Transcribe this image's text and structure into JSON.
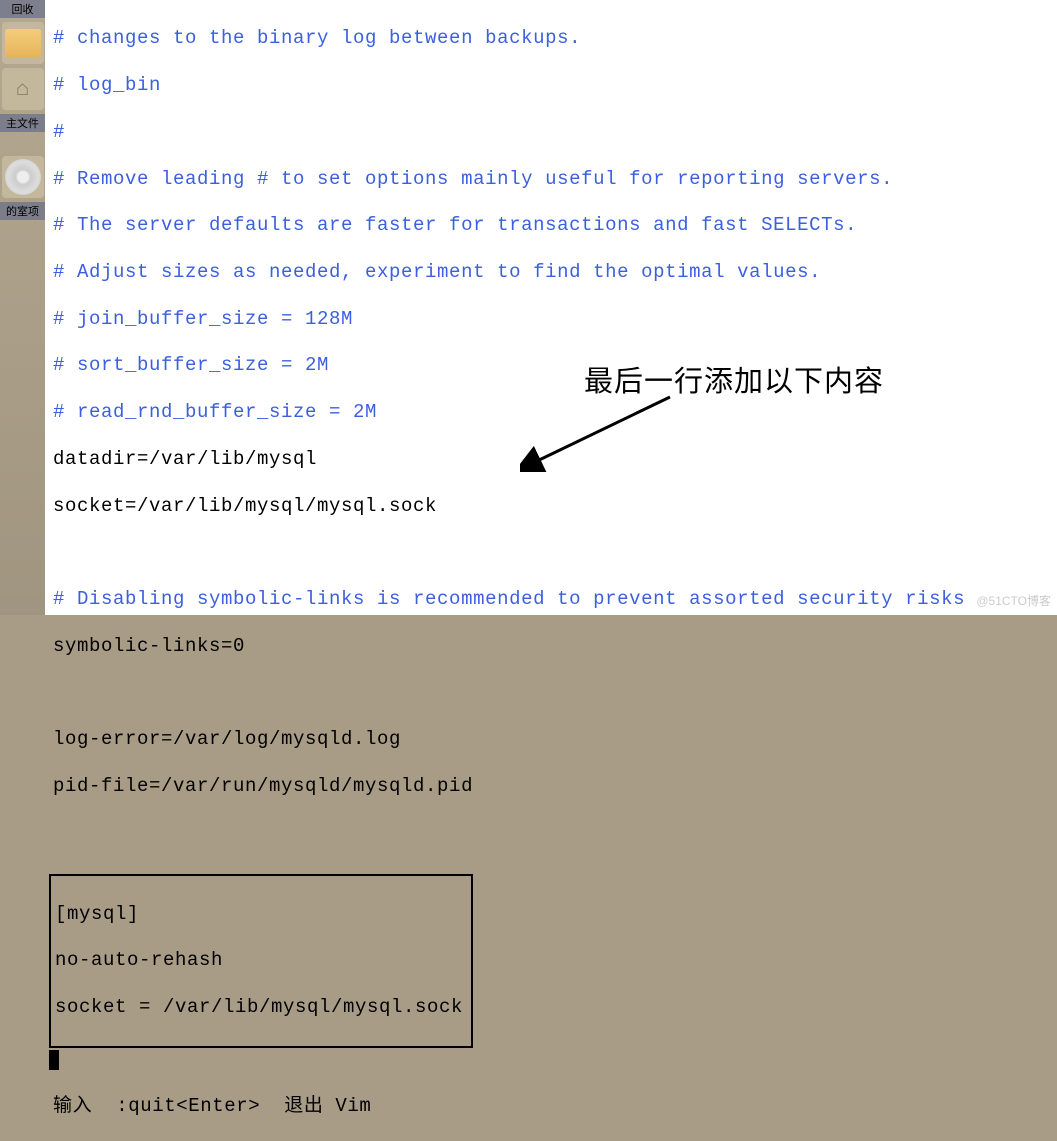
{
  "desktop": {
    "recycle_label": "回收",
    "main_files_label": "主文件",
    "drive_label": "的室项"
  },
  "lines": {
    "l0": "# changes to the binary log between backups.",
    "l1": "# log_bin",
    "l2": "#",
    "l3": "# Remove leading # to set options mainly useful for reporting servers.",
    "l4": "# The server defaults are faster for transactions and fast SELECTs.",
    "l5": "# Adjust sizes as needed, experiment to find the optimal values.",
    "l6": "# join_buffer_size = 128M",
    "l7": "# sort_buffer_size = 2M",
    "l8": "# read_rnd_buffer_size = 2M",
    "l9": "datadir=/var/lib/mysql",
    "l10": "socket=/var/lib/mysql/mysql.sock",
    "l11": " ",
    "l12": "# Disabling symbolic-links is recommended to prevent assorted security risks",
    "l13": "symbolic-links=0",
    "l14": " ",
    "l15": "log-error=/var/log/mysqld.log",
    "l16": "pid-file=/var/run/mysqld/mysqld.pid",
    "box0": "[mysql]",
    "box1": "no-auto-rehash",
    "box2": "socket = /var/lib/mysql/mysql.sock",
    "status": "输入  :quit<Enter>  退出 Vim"
  },
  "annotation": {
    "text": "最后一行添加以下内容"
  },
  "watermark": "@51CTO博客"
}
